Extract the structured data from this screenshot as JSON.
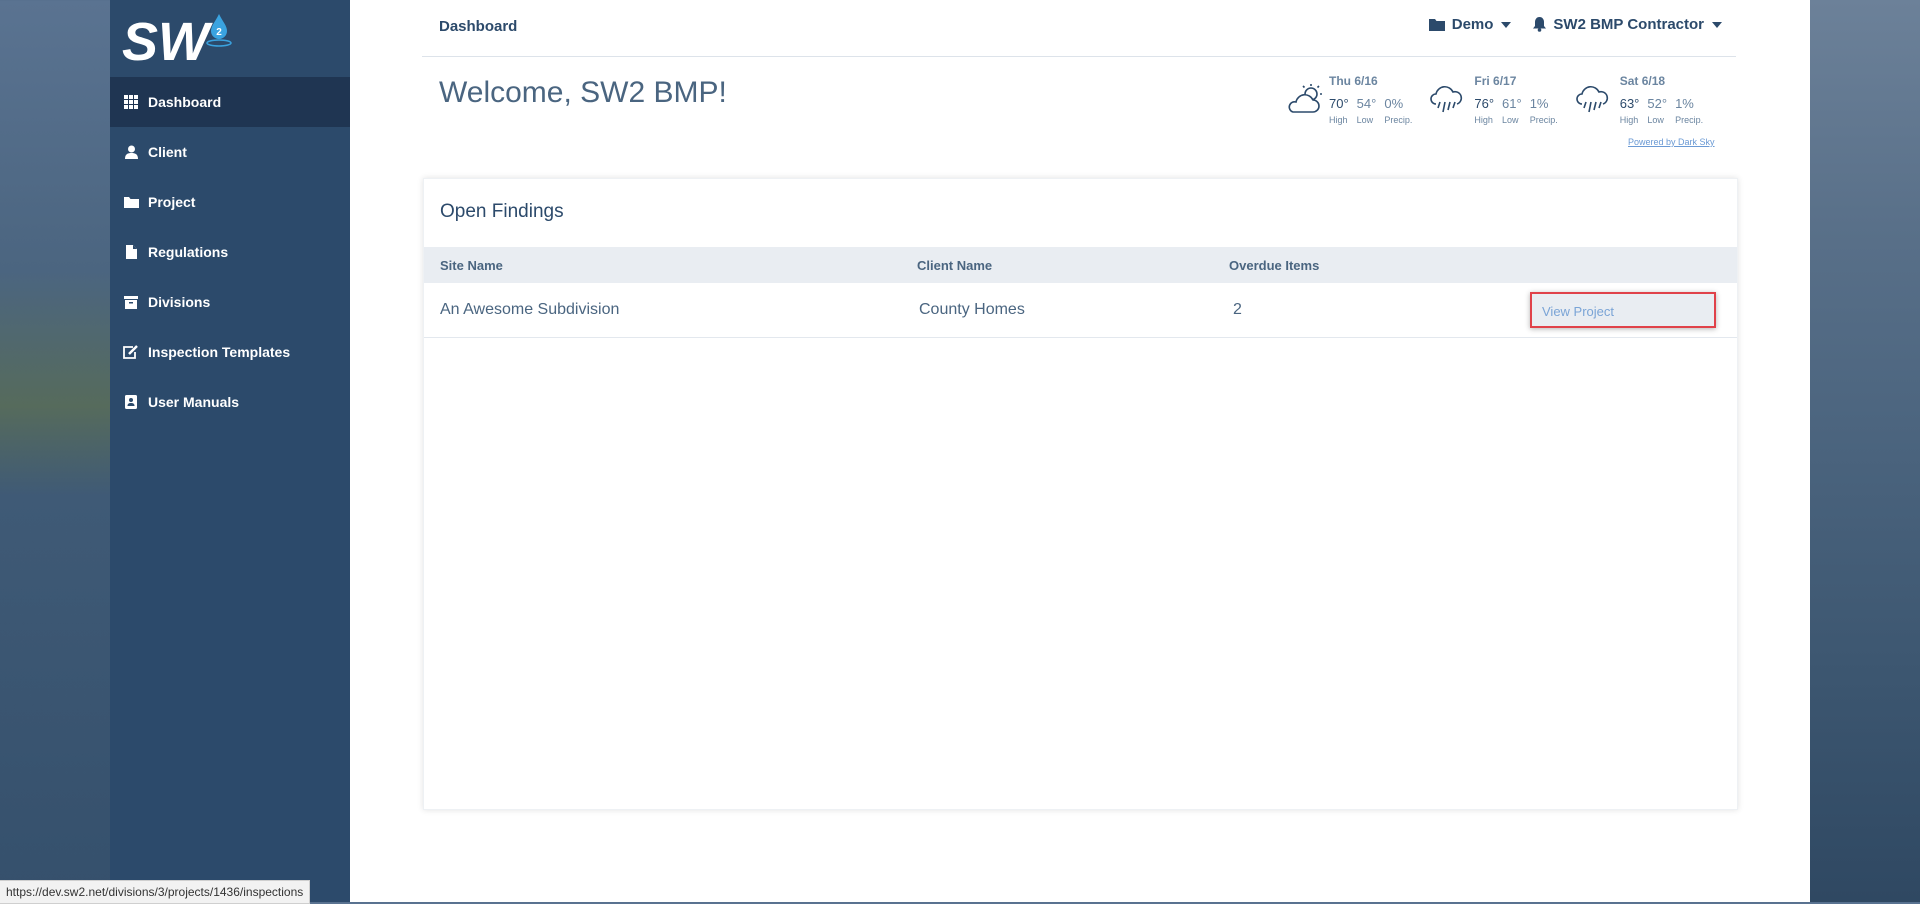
{
  "sidebar": {
    "logo_text": "SW",
    "logo_badge": "2",
    "items": [
      {
        "label": "Dashboard",
        "icon": "grid-icon",
        "active": true
      },
      {
        "label": "Client",
        "icon": "user-icon"
      },
      {
        "label": "Project",
        "icon": "folder-icon"
      },
      {
        "label": "Regulations",
        "icon": "document-icon"
      },
      {
        "label": "Divisions",
        "icon": "archive-icon"
      },
      {
        "label": "Inspection Templates",
        "icon": "edit-icon"
      },
      {
        "label": "User Manuals",
        "icon": "manual-icon"
      }
    ]
  },
  "topbar": {
    "breadcrumb": "Dashboard",
    "org_dropdown": "Demo",
    "user_dropdown": "SW2 BMP Contractor"
  },
  "welcome": "Welcome, SW2 BMP!",
  "weather": {
    "days": [
      {
        "date": "Thu 6/16",
        "high": "70°",
        "low": "54°",
        "precip": "0%",
        "icon": "partly-cloudy-day-icon"
      },
      {
        "date": "Fri 6/17",
        "high": "76°",
        "low": "61°",
        "precip": "1%",
        "icon": "rain-icon"
      },
      {
        "date": "Sat 6/18",
        "high": "63°",
        "low": "52°",
        "precip": "1%",
        "icon": "rain-icon"
      }
    ],
    "labels": {
      "high": "High",
      "low": "Low",
      "precip": "Precip."
    },
    "powered_by": "Powered by Dark Sky"
  },
  "findings": {
    "title": "Open Findings",
    "columns": [
      "Site Name",
      "Client Name",
      "Overdue Items"
    ],
    "rows": [
      {
        "site": "An Awesome Subdivision",
        "client": "County Homes",
        "overdue": "2",
        "action": "View Project"
      }
    ]
  },
  "status_url": "https://dev.sw2.net/divisions/3/projects/1436/inspections",
  "colors": {
    "sidebar": "#2c4a6b",
    "sidebar_active": "#1f3552",
    "accent": "#2c4a6b",
    "highlight": "#e0424a",
    "link": "#7aa4d6"
  }
}
